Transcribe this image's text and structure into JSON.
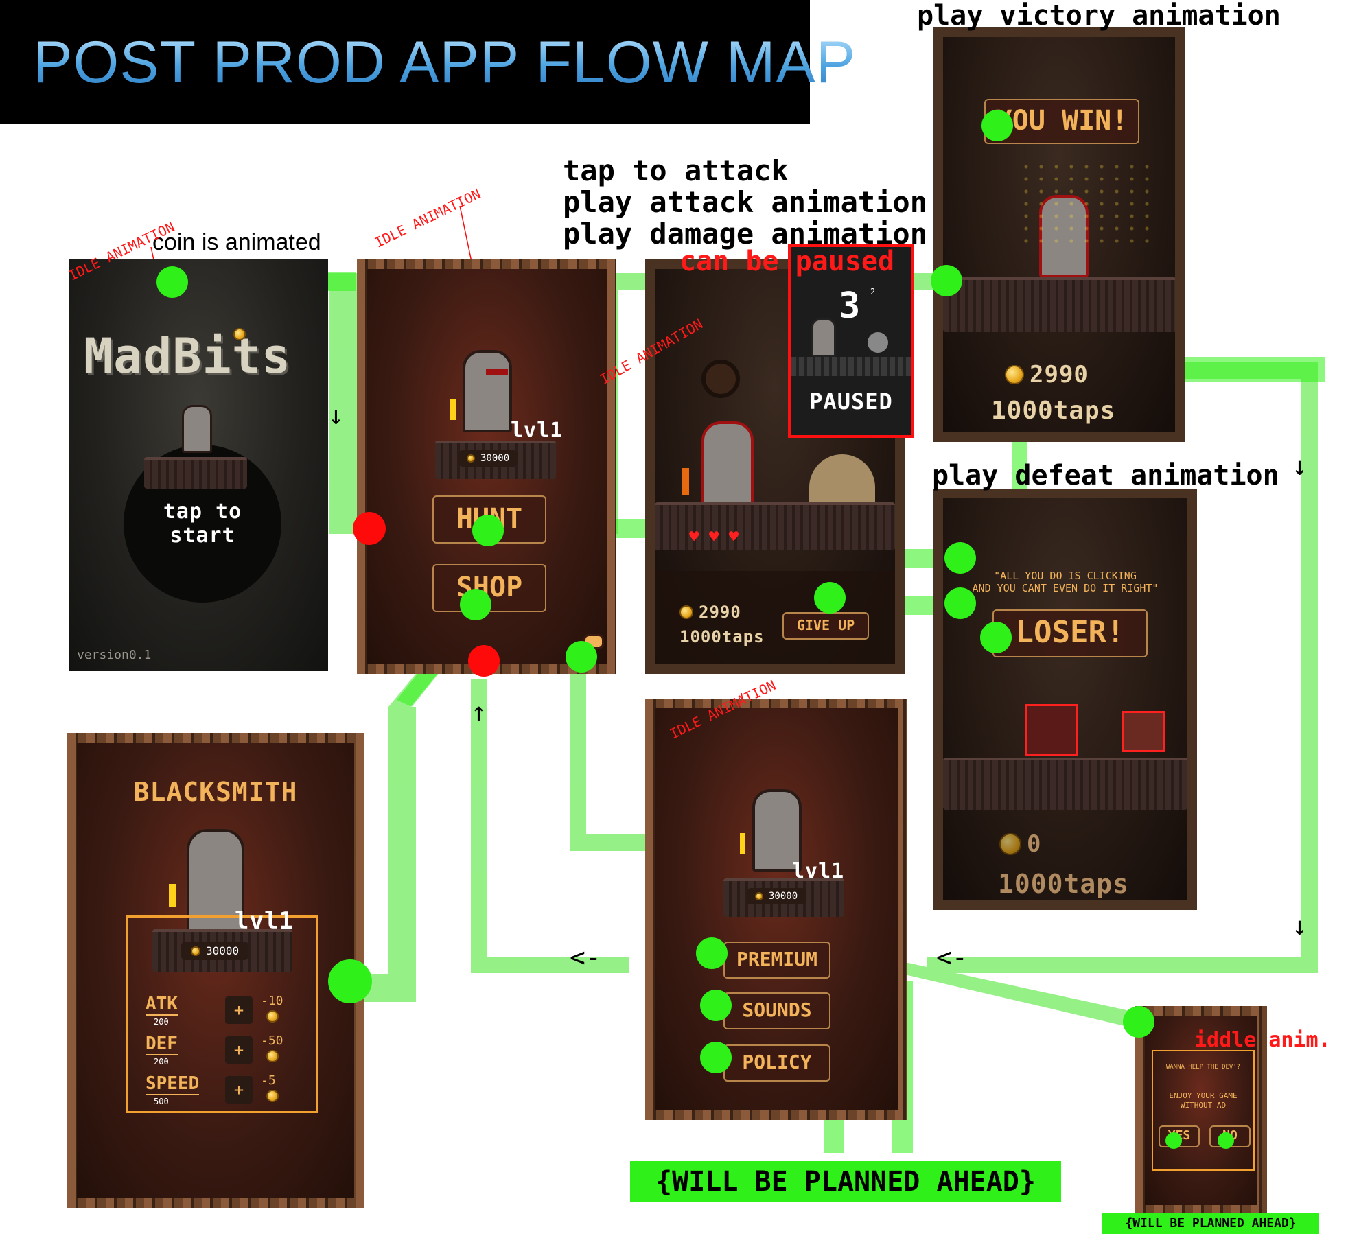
{
  "title": "POST PROD APP FLOW MAP",
  "annotations": {
    "coin_animated": "coin is animated",
    "idle_animation": "IDLE ANIMATION",
    "tap_to_attack": "tap to attack",
    "play_attack": "play attack animation",
    "play_damage": "play damage animation",
    "can_be_paused": "can be paused",
    "play_victory": "play victory animation",
    "play_defeat": "play defeat animation",
    "iddle_anim": "iddle anim.",
    "planned_ahead_big": "{WILL BE PLANNED AHEAD}",
    "planned_ahead_small": "{WILL BE PLANNED AHEAD}"
  },
  "arrows": {
    "down": "↓",
    "up": "↑",
    "left": "<-"
  },
  "screens": {
    "start": {
      "logo": "MadBits",
      "tap": "tap to start",
      "version": "version0.1"
    },
    "menu": {
      "level": "lvl1",
      "coins": "30000",
      "hunt": "HUNT",
      "shop": "SHOP"
    },
    "battle": {
      "coins": "2990",
      "taps": "1000taps",
      "give_up": "GIVE UP",
      "hearts": "♥ ♥ ♥"
    },
    "paused": {
      "countdown": "3",
      "sup": "2",
      "label": "PAUSED"
    },
    "victory": {
      "banner": "YOU WIN!",
      "coins": "2990",
      "taps": "1000taps"
    },
    "defeat": {
      "quote_line1": "\"ALL YOU DO IS CLICKING",
      "quote_line2": "AND YOU CANT EVEN DO IT RIGHT\"",
      "banner": "LOSER!",
      "coins": "0",
      "taps": "1000taps"
    },
    "blacksmith": {
      "title": "BLACKSMITH",
      "level": "lvl1",
      "coins": "30000",
      "stats": [
        {
          "name": "ATK",
          "value": "200",
          "plus": "+",
          "cost": "-10"
        },
        {
          "name": "DEF",
          "value": "200",
          "plus": "+",
          "cost": "-50"
        },
        {
          "name": "SPEED",
          "value": "500",
          "plus": "+",
          "cost": "-5"
        }
      ]
    },
    "settings": {
      "level": "lvl1",
      "coins": "30000",
      "premium": "PREMIUM",
      "sounds": "SOUNDS",
      "policy": "POLICY"
    },
    "premium_popup": {
      "line1": "WANNA HELP THE DEV'?",
      "line2": "ENJOY YOUR GAME",
      "line3": "WITHOUT AD",
      "yes": "YES",
      "no": "NO"
    }
  },
  "colors": {
    "flow_green": "#2ff018",
    "flow_band": "#8af07a",
    "error_red": "#ff0a0a",
    "button_text": "#f2b35a"
  }
}
